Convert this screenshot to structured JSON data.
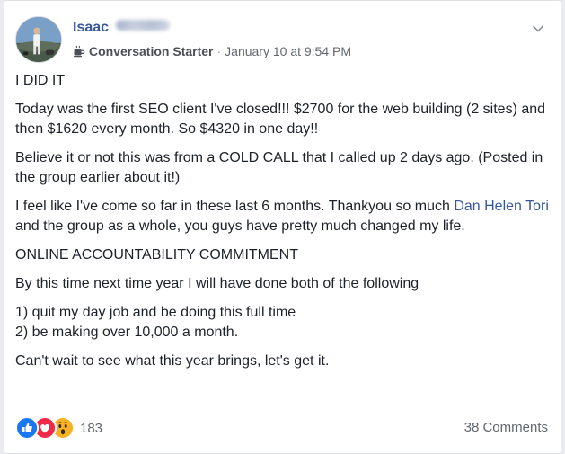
{
  "post": {
    "author": {
      "first_name": "Isaac",
      "avatar_icon": "avatar-photo"
    },
    "badge": {
      "icon": "coffee-cup-icon",
      "label": "Conversation Starter"
    },
    "separator": "·",
    "timestamp": "January 10 at 9:54 PM",
    "content": {
      "line_1": "I DID IT",
      "line_2": "Today was the first SEO client I've closed!!! $2700 for the web building (2 sites) and then $1620 every month. So $4320 in one day!!",
      "line_3": "Believe it or not this was from a COLD CALL that I called up 2 days ago. (Posted in the group earlier about it!)",
      "line_4_before": "I feel like I've come so far in these last 6 months. Thankyou so much ",
      "line_4_mention": "Dan Helen Tori",
      "line_4_after": " and the group as a whole, you guys have pretty much changed my life.",
      "line_5": "ONLINE ACCOUNTABILITY COMMITMENT",
      "line_6": "By this time next time year I will have done both of the following",
      "line_7": "1) quit my day job and be doing this full time",
      "line_8": "2) be making over 10,000 a month.",
      "line_9": "Can't wait to see what this year brings, let's get it."
    },
    "reactions": {
      "icons": [
        "like-icon",
        "love-icon",
        "wow-icon"
      ],
      "count": "183"
    },
    "comments_label": "38 Comments"
  },
  "colors": {
    "link": "#385898",
    "text": "#1d2129",
    "meta": "#616770",
    "like": "#1877f2",
    "love": "#f0284a",
    "wow": "#f7b125"
  }
}
